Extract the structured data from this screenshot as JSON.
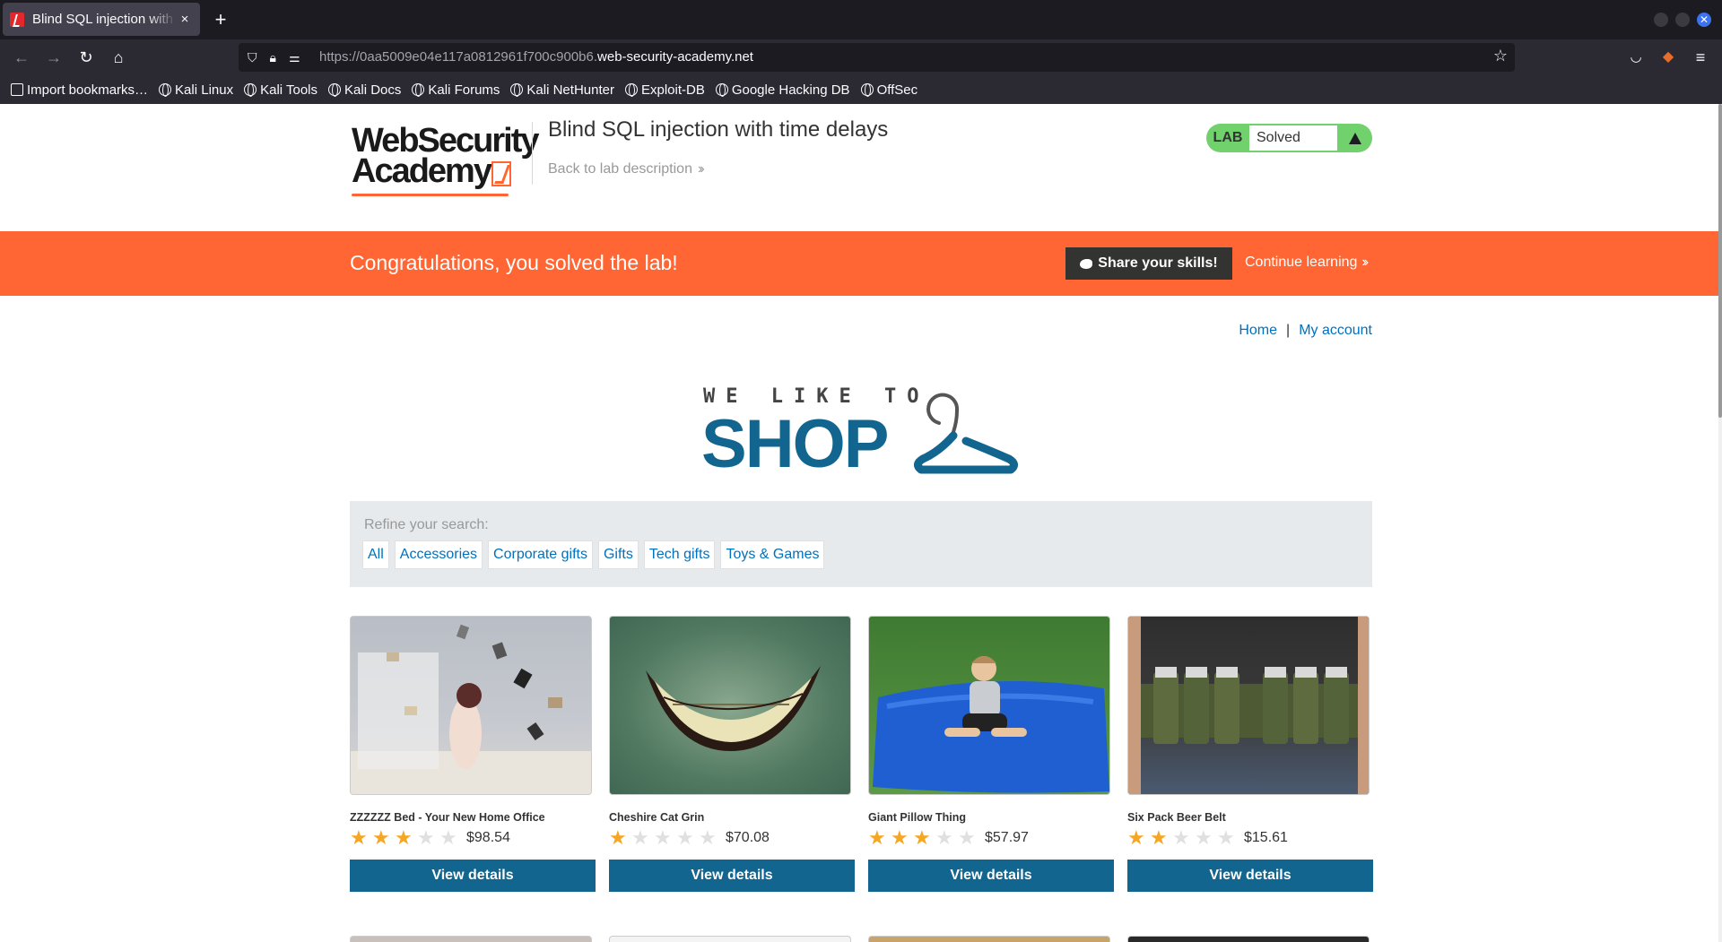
{
  "browser": {
    "tab_title": "Blind SQL injection with time delays",
    "tab_close": "×",
    "new_tab": "+",
    "url_dim": "https://0aa5009e04e117a0812961f700c900b6.",
    "url_main": "web-security-academy.net",
    "bookmarks": [
      "Import bookmarks…",
      "Kali Linux",
      "Kali Tools",
      "Kali Docs",
      "Kali Forums",
      "Kali NetHunter",
      "Exploit-DB",
      "Google Hacking DB",
      "OffSec"
    ]
  },
  "academy": {
    "logo_line1": "WebSecurity",
    "logo_line2": "Academy",
    "lab_title": "Blind SQL injection with time delays",
    "back_link": "Back to lab description",
    "lab_badge": "LAB",
    "lab_status": "Solved",
    "banner_text": "Congratulations, you solved the lab!",
    "share_button": "Share your skills!",
    "continue_link": "Continue learning",
    "accent_color": "#ff6633",
    "solved_color": "#70d16d"
  },
  "nav": {
    "home": "Home",
    "separator": "|",
    "my_account": "My account"
  },
  "shop_logo": {
    "line1": "WE LIKE TO",
    "line2": "SHOP"
  },
  "filter": {
    "label": "Refine your search:",
    "categories": [
      "All",
      "Accessories",
      "Corporate gifts",
      "Gifts",
      "Tech gifts",
      "Toys & Games"
    ]
  },
  "products": [
    {
      "name": "ZZZZZZ Bed - Your New Home Office",
      "rating": 3,
      "price": "$98.54",
      "button": "View details"
    },
    {
      "name": "Cheshire Cat Grin",
      "rating": 1,
      "price": "$70.08",
      "button": "View details"
    },
    {
      "name": "Giant Pillow Thing",
      "rating": 3,
      "price": "$57.97",
      "button": "View details"
    },
    {
      "name": "Six Pack Beer Belt",
      "rating": 2,
      "price": "$15.61",
      "button": "View details"
    }
  ]
}
